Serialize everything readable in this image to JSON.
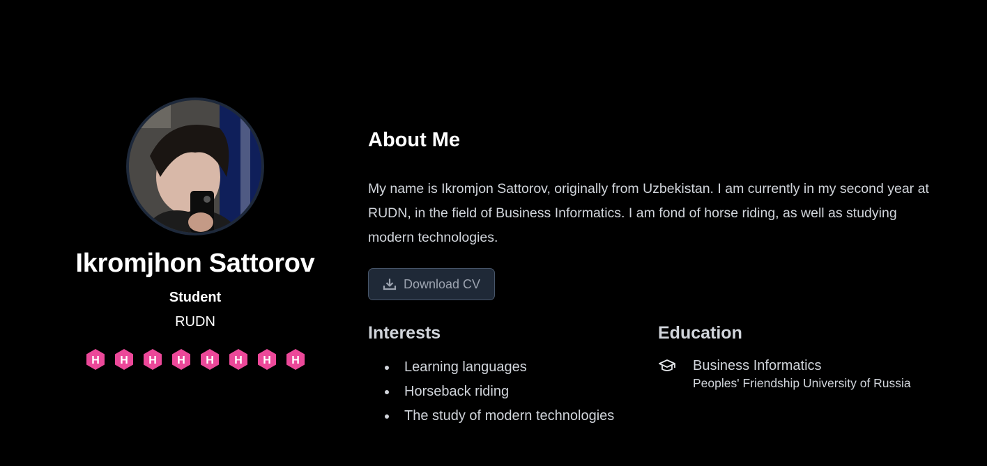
{
  "profile": {
    "name": "Ikromjhon Sattorov",
    "role": "Student",
    "organization": "RUDN",
    "avatar_icon": "user-photo",
    "badges": [
      {
        "letter": "H",
        "icon": "hexagon-h-badge-icon",
        "color": "#ec4899"
      },
      {
        "letter": "H",
        "icon": "hexagon-h-badge-icon",
        "color": "#ec4899"
      },
      {
        "letter": "H",
        "icon": "hexagon-h-badge-icon",
        "color": "#ec4899"
      },
      {
        "letter": "H",
        "icon": "hexagon-h-badge-icon",
        "color": "#ec4899"
      },
      {
        "letter": "H",
        "icon": "hexagon-h-badge-icon",
        "color": "#ec4899"
      },
      {
        "letter": "H",
        "icon": "hexagon-h-badge-icon",
        "color": "#ec4899"
      },
      {
        "letter": "H",
        "icon": "hexagon-h-badge-icon",
        "color": "#ec4899"
      },
      {
        "letter": "H",
        "icon": "hexagon-h-badge-icon",
        "color": "#ec4899"
      }
    ]
  },
  "about": {
    "title": "About Me",
    "text": "My name is Ikromjon Sattorov, originally from Uzbekistan. I am currently in my second year at RUDN, in the field of Business Informatics. I am fond of horse riding, as well as studying modern technologies.",
    "cv_button": {
      "label": "Download CV",
      "icon": "download-icon"
    }
  },
  "interests": {
    "title": "Interests",
    "items": [
      "Learning languages",
      "Horseback riding",
      "The study of modern technologies"
    ]
  },
  "education": {
    "title": "Education",
    "items": [
      {
        "icon": "graduation-cap-icon",
        "title": "Business Informatics",
        "institution": "Peoples' Friendship University of Russia"
      }
    ]
  },
  "colors": {
    "background": "#000000",
    "badge": "#ec4899",
    "button_bg": "#1f2937",
    "avatar_border": "#1e293b",
    "muted_text": "#d1d5db"
  }
}
